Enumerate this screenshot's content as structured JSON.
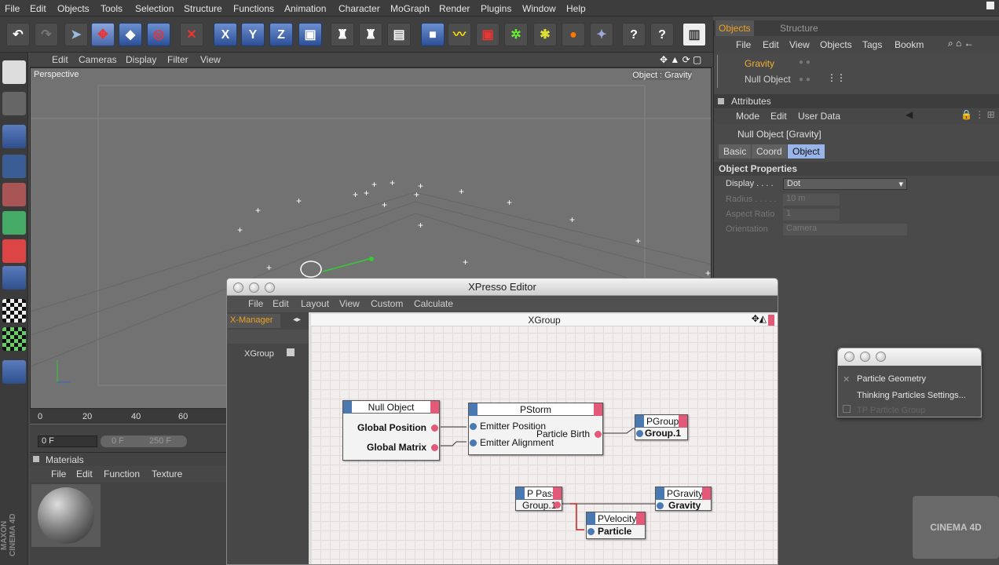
{
  "menubar": {
    "items": [
      "File",
      "Edit",
      "Objects",
      "Tools",
      "Selection",
      "Structure",
      "Functions",
      "Animation",
      "Character",
      "MoGraph",
      "Render",
      "Plugins",
      "Window",
      "Help"
    ]
  },
  "viewport": {
    "menu": [
      "Edit",
      "Cameras",
      "Display",
      "Filter",
      "View"
    ],
    "camera_label": "Perspective",
    "object_label": "Object : Gravity"
  },
  "timeline": {
    "ticks": [
      "0",
      "20",
      "40",
      "60"
    ],
    "current_frame": "0 F",
    "range_start": "0 F",
    "range_end": "250 F"
  },
  "materials": {
    "title": "Materials",
    "menu": [
      "File",
      "Edit",
      "Function",
      "Texture"
    ]
  },
  "objects_panel": {
    "tabs": [
      "Objects",
      "Structure"
    ],
    "menu": [
      "File",
      "Edit",
      "View",
      "Objects",
      "Tags",
      "Bookm"
    ],
    "tree": [
      {
        "label": "Gravity",
        "highlight": "#f0b030"
      },
      {
        "label": "Null Object",
        "highlight": "#d0d0d0"
      }
    ]
  },
  "attributes_panel": {
    "title": "Attributes",
    "menu": [
      "Mode",
      "Edit",
      "User Data"
    ],
    "object_name": "Null Object [Gravity]",
    "tabs": [
      "Basic",
      "Coord",
      "Object"
    ],
    "active_tab": "Object",
    "section": "Object Properties",
    "fields": [
      {
        "label": "Display . . . .",
        "value": "Dot",
        "enabled": true
      },
      {
        "label": "Radius . . . . .",
        "value": "10 m",
        "enabled": false
      },
      {
        "label": "Aspect Ratio",
        "value": "1",
        "enabled": false
      },
      {
        "label": "Orientation",
        "value": "Camera",
        "enabled": false
      }
    ]
  },
  "xpresso": {
    "title": "XPresso Editor",
    "menu": [
      "File",
      "Edit",
      "Layout",
      "View",
      "Custom",
      "Calculate"
    ],
    "manager_tab": "X-Manager",
    "tree_item": "XGroup",
    "canvas_title": "XGroup",
    "nodes": {
      "null_object": {
        "title": "Null Object",
        "ports": [
          "Global Position",
          "Global Matrix"
        ]
      },
      "pstorm": {
        "title": "PStorm",
        "in_ports": [
          "Emitter Position",
          "Emitter Alignment"
        ],
        "out_port": "Particle Birth"
      },
      "pgroup": {
        "title": "PGroup",
        "port": "Group.1"
      },
      "ppass": {
        "title": "P Pass",
        "port": "Group.1"
      },
      "pgravity": {
        "title": "PGravity",
        "port": "Gravity"
      },
      "pvelocity": {
        "title": "PVelocity",
        "port": "Particle"
      }
    }
  },
  "popup_menu": {
    "items": [
      "Particle Geometry",
      "Thinking Particles Settings...",
      "TP Particle Group"
    ]
  },
  "watermark": "CINEMA 4D",
  "side_brand": "MAXON CINEMA 4D",
  "colors": {
    "accent_orange": "#f0a020",
    "port_blue": "#4a78b0",
    "port_red": "#e25a78"
  }
}
